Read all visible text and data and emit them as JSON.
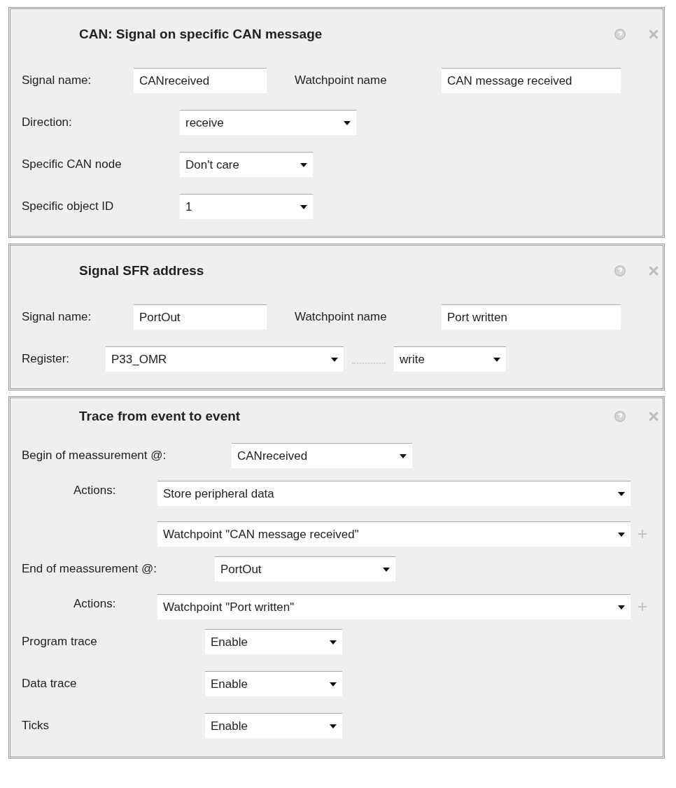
{
  "panels": [
    {
      "kind": "can_signal",
      "title": "CAN: Signal on specific CAN message",
      "signal_name": {
        "label": "Signal name:",
        "value": "CANreceived"
      },
      "watchpoint_name": {
        "label": "Watchpoint name",
        "value": "CAN message received"
      },
      "settings": [
        {
          "label": "Direction:",
          "value": "receive"
        },
        {
          "label": "Specific CAN node",
          "value": "Don't care"
        },
        {
          "label": "Specific object ID",
          "value": "1"
        }
      ]
    },
    {
      "kind": "sfr",
      "title": "Signal SFR address",
      "signal_name": {
        "label": "Signal name:",
        "value": "PortOut"
      },
      "watchpoint_name": {
        "label": "Watchpoint name",
        "value": "Port written"
      },
      "register": {
        "label": "Register:",
        "value": "P33_OMR",
        "access": "write"
      }
    },
    {
      "kind": "trace",
      "title": "Trace from event to event",
      "begin": {
        "label": "Begin of meassurement @:",
        "value": "CANreceived",
        "actions_label": "Actions:",
        "actions": [
          "Store peripheral data",
          "Watchpoint \"CAN message received\""
        ]
      },
      "end": {
        "label": "End of meassurement @:",
        "value": "PortOut",
        "actions_label": "Actions:",
        "actions": [
          "Watchpoint \"Port written\""
        ]
      },
      "options": [
        {
          "label": "Program trace",
          "value": "Enable"
        },
        {
          "label": "Data trace",
          "value": "Enable"
        },
        {
          "label": "Ticks",
          "value": "Enable"
        }
      ]
    }
  ]
}
